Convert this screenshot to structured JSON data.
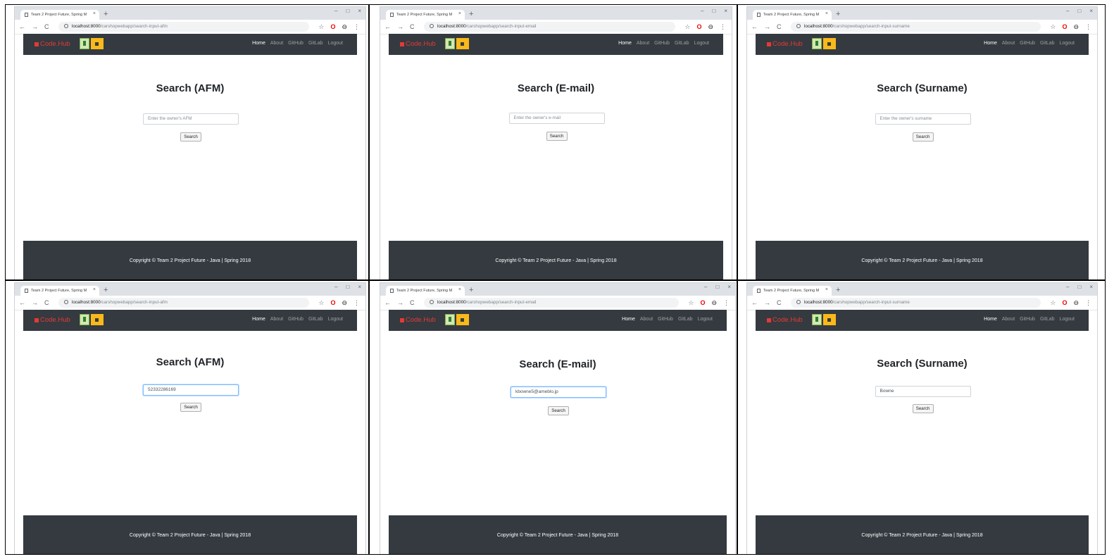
{
  "browser": {
    "tab_title": "Team 2 Project Future, Spring M",
    "tab_close": "×",
    "new_tab": "+",
    "win_min": "–",
    "win_max": "□",
    "win_close": "×",
    "back": "←",
    "forward": "→",
    "reload": "C",
    "url_host": "localhost:8000",
    "star": "☆",
    "opera": "O",
    "avatar": "⊖",
    "menu_dots": "⋮"
  },
  "navbar": {
    "brand": "Code.Hub",
    "links": [
      "Home",
      "About",
      "GitHub",
      "GitLab",
      "Logout"
    ]
  },
  "footer": {
    "text": "Copyright © Team 2 Project Future - Java | Spring 2018"
  },
  "search_button": "Search",
  "panels": [
    {
      "path": "/carshopwebapp/search-input-afm",
      "title": "Search (AFM)",
      "placeholder": "Enter the owner's AFM",
      "value": ""
    },
    {
      "path": "/carshopwebapp/search-input-email",
      "title": "Search (E-mail)",
      "placeholder": "Enter the owner's e-mail",
      "value": ""
    },
    {
      "path": "/carshopwebapp/search-input-surname",
      "title": "Search (Surname)",
      "placeholder": "Enter the owner's surname",
      "value": ""
    },
    {
      "path": "/carshopwebapp/search-input-afm",
      "title": "Search (AFM)",
      "placeholder": "Enter the owner's AFM",
      "value": "52332286169"
    },
    {
      "path": "/carshopwebapp/search-input-email",
      "title": "Search (E-mail)",
      "placeholder": "Enter the owner's e-mail",
      "value": "kbowne5@ameblo.jp"
    },
    {
      "path": "/carshopwebapp/search-input-surname",
      "title": "Search (Surname)",
      "placeholder": "Enter the owner's surname",
      "value": "Bowne"
    }
  ]
}
